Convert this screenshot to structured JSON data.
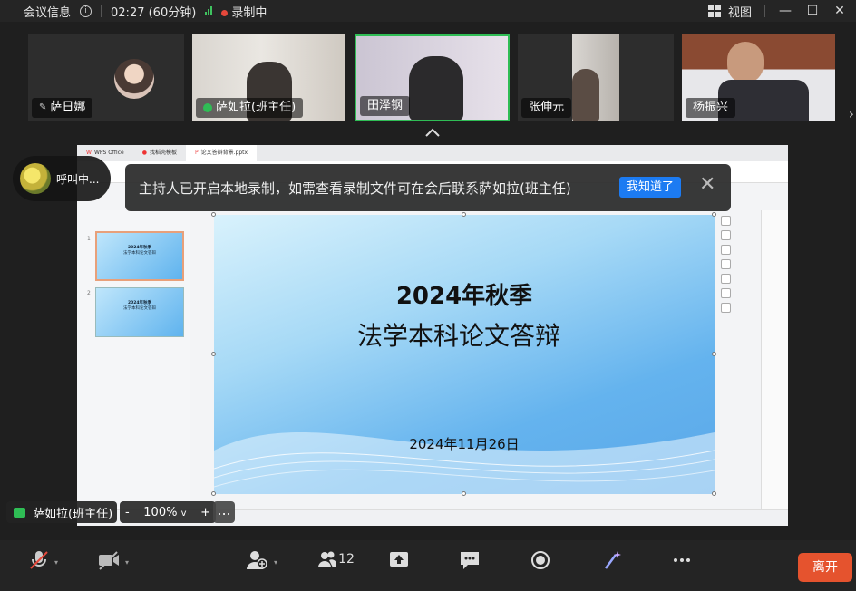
{
  "topbar": {
    "meeting_info": "会议信息",
    "timer": "02:27 (60分钟)",
    "recording": "录制中",
    "view": "视图"
  },
  "participants": [
    {
      "name": "萨日娜"
    },
    {
      "name": "萨如拉(班主任)"
    },
    {
      "name": "田泽钢"
    },
    {
      "name": "张伸元"
    },
    {
      "name": "杨振兴"
    }
  ],
  "notice": {
    "text": "主持人已开启本地录制，如需查看录制文件可在会后联系萨如拉(班主任)",
    "button": "我知道了"
  },
  "caller": {
    "label": "呼叫中..."
  },
  "wps": {
    "tabs": [
      "WPS Office",
      "找稻壳模板",
      "论文答辩背景.pptx"
    ],
    "slide": {
      "title_line1": "2024年秋季",
      "title_line2": "法学本科论文答辩",
      "date": "2024年11月26日"
    },
    "thumb_text_1": "2024年秋季",
    "thumb_text_2": "法学本科论文答辩",
    "thumb_numbers": [
      "1",
      "2"
    ]
  },
  "share_controls": {
    "speaker": "萨如拉(班主任)",
    "zoom_minus": "-",
    "zoom_value": "100%",
    "zoom_plus": "+",
    "more": "..."
  },
  "bottombar": {
    "participant_count": "12",
    "leave": "离开"
  },
  "colors": {
    "accent_green": "#2fbd55",
    "leave": "#e5532e",
    "notice_button": "#1c7bf2"
  }
}
